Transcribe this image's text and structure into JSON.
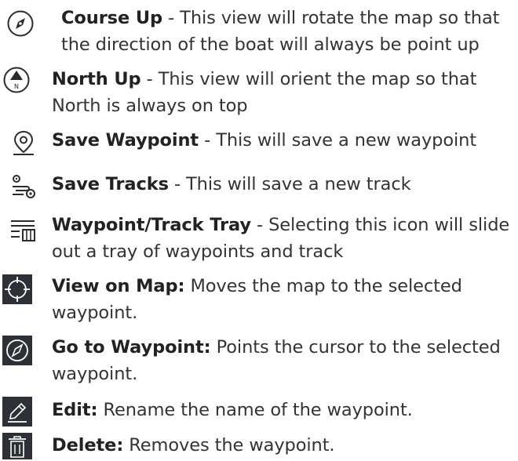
{
  "items": [
    {
      "term": "Course Up",
      "line1": " - This view will rotate the map so that",
      "line2": "the direction of the boat will always be point up",
      "icon": "compass-outline-icon"
    },
    {
      "term": "North Up",
      "line1": " - This view will orient the map so that",
      "line2": "North is always on top",
      "icon": "north-arrow-icon",
      "icon_letter": "N"
    },
    {
      "term": "Save Waypoint",
      "line1": " - This will save a new waypoint",
      "icon": "location-pin-icon"
    },
    {
      "term": "Save Tracks",
      "line1": " - This will save a new track",
      "icon": "route-track-icon"
    },
    {
      "term": "Waypoint/Track Tray",
      "line1": " - Selecting this icon will slide",
      "line2": "out a tray of waypoints and track",
      "icon": "tray-list-icon"
    },
    {
      "term": "View on Map:",
      "line1": " Moves the map to the selected",
      "line2": "waypoint.",
      "icon": "crosshair-icon"
    },
    {
      "term": "Go to Waypoint:",
      "line1": " Points the cursor to the selected",
      "line2": "waypoint.",
      "icon": "compass-dark-icon"
    },
    {
      "term": "Edit:",
      "line1": " Rename the name of the waypoint.",
      "icon": "pencil-icon"
    },
    {
      "term": "Delete:",
      "line1": " Removes the waypoint.",
      "icon": "trash-icon"
    }
  ],
  "colors": {
    "dark_icon_bg": "#2d3136",
    "text": "#333333",
    "icon_stroke": "#2b2b2b"
  }
}
